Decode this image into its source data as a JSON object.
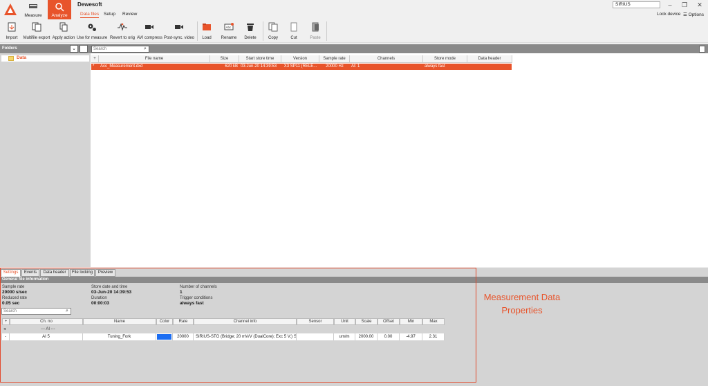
{
  "app": {
    "title": "Dewesoft",
    "modes": [
      {
        "label": "Measure"
      },
      {
        "label": "Analyze"
      }
    ],
    "ribbon_tabs": [
      "Data files",
      "Setup",
      "Review"
    ],
    "device": "SIRIUS",
    "lock_device": "Lock device",
    "options": "Options"
  },
  "toolbar": {
    "items": [
      {
        "label": "Import",
        "icon": "import-icon"
      },
      {
        "label": "Multifile export",
        "icon": "multifile-export-icon"
      },
      {
        "label": "Apply action",
        "icon": "apply-action-icon"
      },
      {
        "label": "Use for measure",
        "icon": "gears-icon"
      },
      {
        "label": "Revert to orig",
        "icon": "revert-icon"
      },
      {
        "label": "AVI compress",
        "icon": "video-camera-icon"
      },
      {
        "label": "Post-sync. video",
        "icon": "video-camera-icon"
      },
      {
        "label": "Load",
        "icon": "folder-open-icon"
      },
      {
        "label": "Rename",
        "icon": "rename-icon"
      },
      {
        "label": "Delete",
        "icon": "trash-icon"
      },
      {
        "label": "Copy",
        "icon": "copy-icon"
      },
      {
        "label": "Cut",
        "icon": "cut-icon"
      },
      {
        "label": "Paste",
        "icon": "paste-icon"
      }
    ]
  },
  "folders": {
    "header": "Folders",
    "items": [
      {
        "label": "Data"
      }
    ]
  },
  "files": {
    "search_placeholder": "Search",
    "columns": [
      "+",
      "File name",
      "Size",
      "Start store time",
      "Version",
      "Sample rate",
      "Channels",
      "Store mode",
      "Data header"
    ],
    "rows": [
      {
        "marker": "*",
        "name": "Acc_Measurement.dxd",
        "size": "620 kB",
        "start": "03-Jun-20 14:39:53",
        "version": "X3 SP11 (RELE...",
        "rate": "20000 Hz",
        "channels": "AI: 1",
        "store_mode": "always fast",
        "data_header": ""
      }
    ]
  },
  "properties": {
    "tabs": [
      "Settings",
      "Events",
      "Data header",
      "File locking",
      "Preview"
    ],
    "section_header": "General file information",
    "fields": {
      "sample_rate_label": "Sample rate",
      "sample_rate": "20000 s/sec",
      "reduced_rate_label": "Reduced rate",
      "reduced_rate": "0.05 sec",
      "store_date_label": "Store date and time",
      "store_date": "03-Jun-20 14:39:53",
      "duration_label": "Duration",
      "duration": "00:00:03",
      "num_channels_label": "Number of channels",
      "num_channels": "1",
      "trigger_label": "Trigger conditions",
      "trigger": "always fast"
    },
    "channel_search_placeholder": "Search",
    "channel_columns": [
      "+",
      "Ch. no",
      "Name",
      "Color",
      "Rate",
      "Channel info",
      "Sensor",
      "Unit",
      "Scale",
      "Offset",
      "Min",
      "Max"
    ],
    "group_label": "--- AI ---",
    "channels": [
      {
        "marker": "-",
        "ch_no": "AI 5",
        "name": "Tuning_Fork",
        "color": "#1c6ef2",
        "rate": "20000",
        "info": "SIRIUS-STG (Bridge; 20 mV/V (DualCore); Exc 5 V;) S...",
        "sensor": "",
        "unit": "um/m",
        "scale": "2000.00",
        "offset": "0.00",
        "min": "-4.97",
        "max": "2.31"
      }
    ]
  },
  "annotation": {
    "line1": "Measurement Data",
    "line2": "Properties",
    "color": "#e8542b"
  }
}
